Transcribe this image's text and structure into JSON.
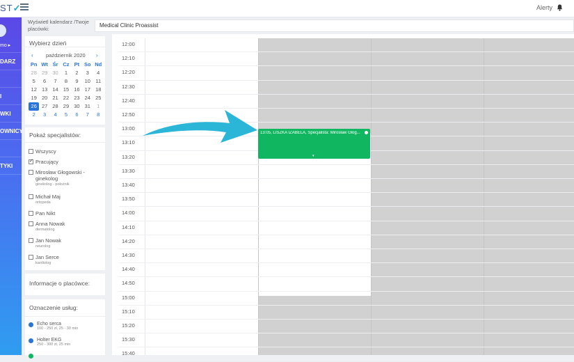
{
  "topbar": {
    "logo_text": "ST",
    "alerts_label": "Alerty"
  },
  "sidebar": {
    "user_label": "mo ▸",
    "items": [
      "DARZ",
      "",
      "I",
      "WKI",
      "OWNICY",
      "",
      "TYKI"
    ]
  },
  "filter": {
    "label": "Wyświetl kalendarz /Twoje placówki:",
    "selected": "Medical Clinic Proassist"
  },
  "day_picker": {
    "title": "Wybierz dzień",
    "prev": "‹",
    "next": "›",
    "month": "październik 2020",
    "weekday_headers": [
      "Pn",
      "Wt",
      "Śr",
      "Cz",
      "Pt",
      "So",
      "Nd"
    ],
    "weeks": [
      [
        "28",
        "29",
        "30",
        "1",
        "2",
        "3",
        "4"
      ],
      [
        "5",
        "6",
        "7",
        "8",
        "9",
        "10",
        "11"
      ],
      [
        "12",
        "13",
        "14",
        "15",
        "16",
        "17",
        "18"
      ],
      [
        "19",
        "20",
        "21",
        "22",
        "23",
        "24",
        "25"
      ],
      [
        "26",
        "27",
        "28",
        "29",
        "30",
        "31",
        "1"
      ],
      [
        "2",
        "3",
        "4",
        "5",
        "6",
        "7",
        "8"
      ]
    ]
  },
  "specialists": {
    "title": "Pokaż specjalistów:",
    "items": [
      {
        "name": "Wszyscy",
        "sub": "",
        "checked": false
      },
      {
        "name": "Pracujący",
        "sub": "",
        "checked": true
      },
      {
        "name": "Mirosław Głogowski - ginekolog",
        "sub": "ginekolog - położnik",
        "checked": false
      },
      {
        "name": "Michał Maj",
        "sub": "ortopeda",
        "checked": false
      },
      {
        "name": "Pan Nikt",
        "sub": "",
        "checked": false
      },
      {
        "name": "Anna Nowak",
        "sub": "dermatolog",
        "checked": false
      },
      {
        "name": "Jan Nowak",
        "sub": "neurolog",
        "checked": false
      },
      {
        "name": "Jan Serce",
        "sub": "kardiolog",
        "checked": false
      }
    ]
  },
  "clinic_info": {
    "title": "Informacje o placówce:"
  },
  "services": {
    "title": "Oznaczenie usług:",
    "items": [
      {
        "name": "Echo serca",
        "sub": "100 - 250 zł, 25 - 30 min",
        "color": "#2a74d8"
      },
      {
        "name": "Holter EKG",
        "sub": "250 - 300 zł, 25 min",
        "color": "#2a74d8"
      }
    ]
  },
  "schedule": {
    "times": [
      "12:00",
      "12:10",
      "12:20",
      "12:30",
      "12:40",
      "12:50",
      "13:00",
      "13:10",
      "13:20",
      "13:30",
      "13:40",
      "13:50",
      "14:00",
      "14:10",
      "14:20",
      "14:30",
      "14:40",
      "14:50",
      "15:00",
      "15:10",
      "15:20",
      "15:30",
      "15:40"
    ],
    "event": {
      "text": "13:05, LISZKA IZABELA, Specjalista: Mirosław Głog...",
      "color": "#10b760"
    },
    "colors": {
      "unavailable": "#d1d1d1",
      "event": "#10b760",
      "arrow": "#2bb5d6",
      "accent": "#2a74d8"
    }
  }
}
